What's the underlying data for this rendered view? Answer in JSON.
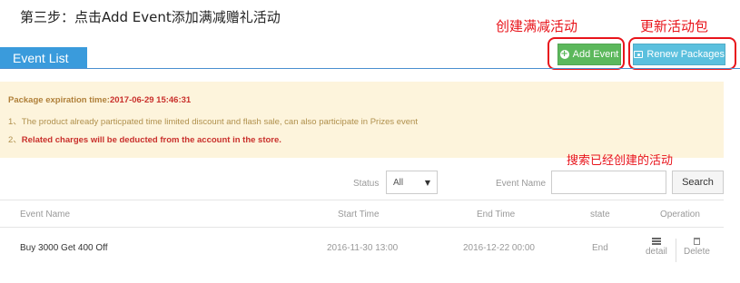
{
  "step_title": "第三步：点击Add Event添加满减赠礼活动",
  "annotations": {
    "create": "创建满减活动",
    "renew": "更新活动包",
    "search": "搜索已经创建的活动"
  },
  "toolbar": {
    "add_event": "Add Event",
    "renew_packages": "Renew Packages"
  },
  "tab": {
    "label": "Event List"
  },
  "notice": {
    "expiration_label": "Package expiration time:",
    "expiration_value": "2017-06-29 15:46:31",
    "line1_num": "1、",
    "line1": "The product already particpated time limited discount and flash sale, can also participate in Prizes event",
    "line2_num": "2、",
    "line2": "Related charges will be deducted from the account in the store."
  },
  "filters": {
    "status_label": "Status",
    "status_value": "All",
    "event_name_label": "Event Name",
    "event_name_value": "",
    "search_button": "Search"
  },
  "table": {
    "headers": {
      "event_name": "Event Name",
      "start_time": "Start Time",
      "end_time": "End Time",
      "state": "state",
      "operation": "Operation"
    },
    "rows": [
      {
        "event_name": "Buy 3000 Get 400 Off",
        "start_time": "2016-11-30 13:00",
        "end_time": "2016-12-22 00:00",
        "state": "End",
        "detail": "detail",
        "delete": "Delete"
      }
    ]
  },
  "colors": {
    "annotation_red": "#e8141b",
    "add_green": "#5cb85c",
    "renew_blue": "#5bc0de",
    "tab_blue": "#3a9bdc",
    "notice_bg": "#fdf4dc"
  },
  "icons": {
    "add": "plus-circle-icon",
    "renew": "package-icon",
    "dropdown": "caret-down-icon",
    "detail": "list-icon",
    "delete": "trash-icon"
  }
}
